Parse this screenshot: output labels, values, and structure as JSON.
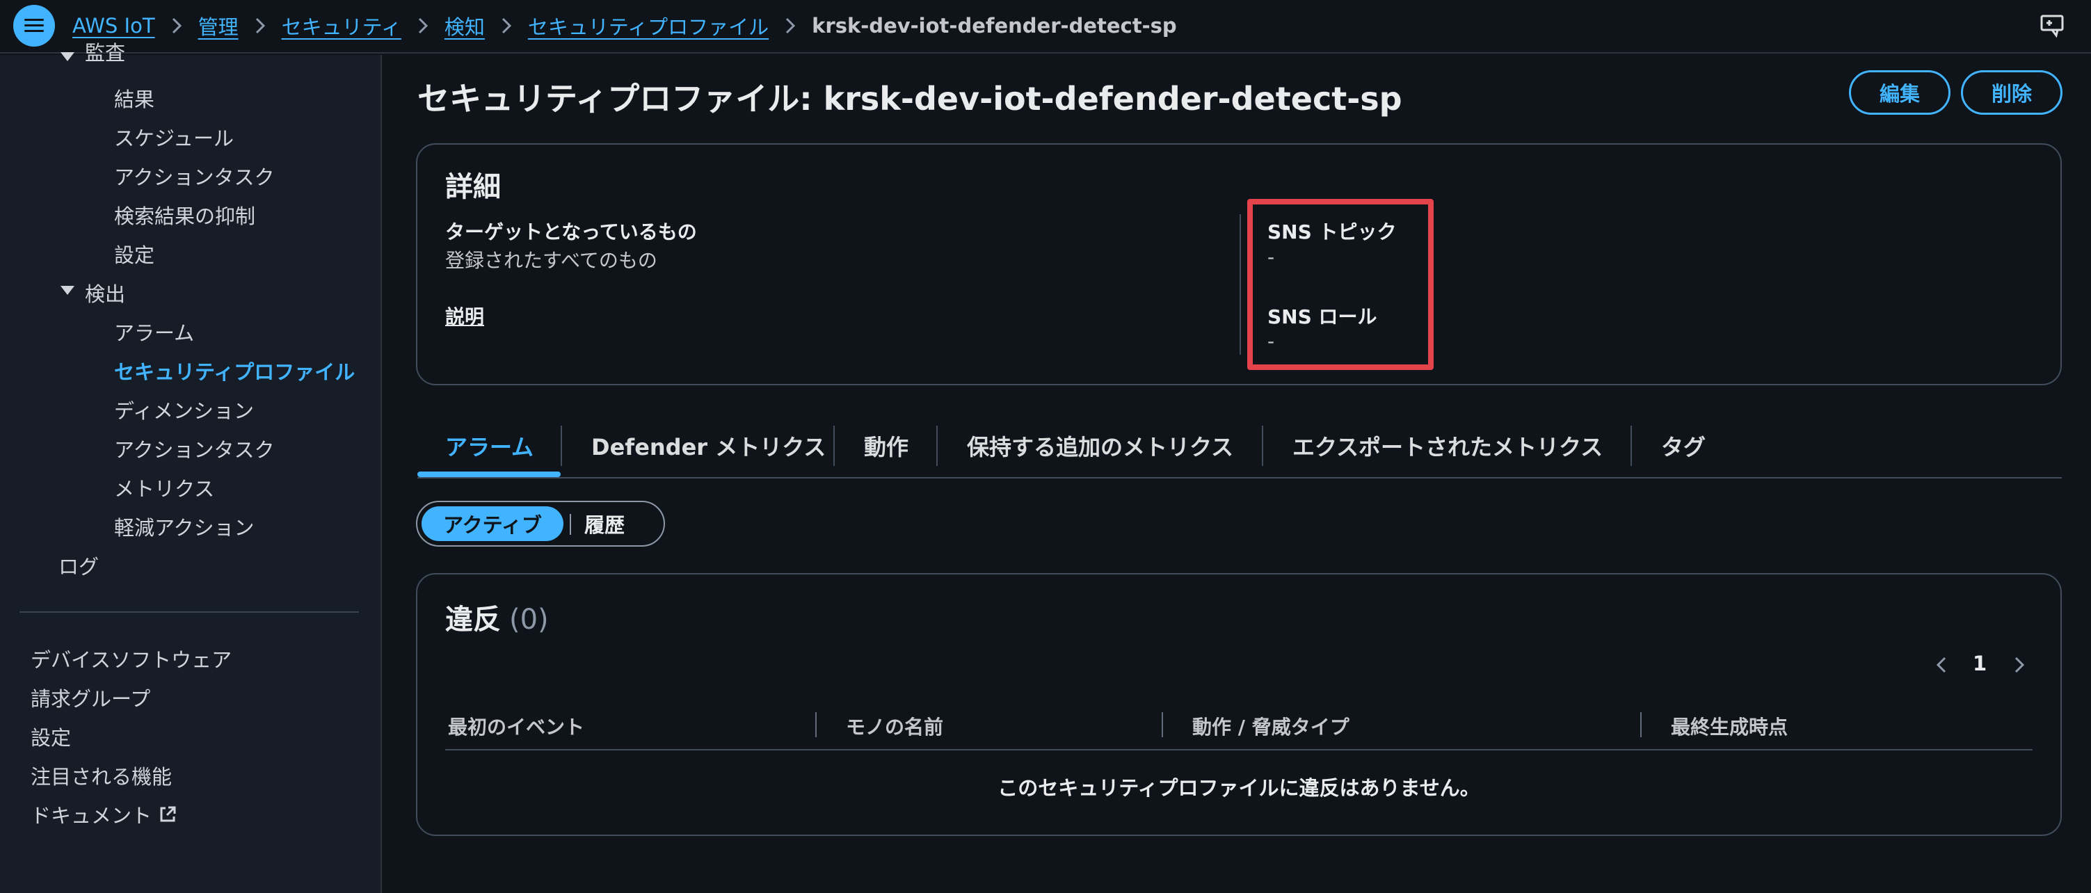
{
  "breadcrumb": {
    "items": [
      "AWS IoT",
      "管理",
      "セキュリティ",
      "検知",
      "セキュリティプロファイル"
    ],
    "current": "krsk-dev-iot-defender-detect-sp"
  },
  "sidebar": {
    "partial_top": "監査",
    "audit_items": [
      "結果",
      "スケジュール",
      "アクションタスク",
      "検索結果の抑制",
      "設定"
    ],
    "detect_label": "検出",
    "detect_items": [
      "アラーム",
      "セキュリティプロファイル",
      "ディメンション",
      "アクションタスク",
      "メトリクス",
      "軽減アクション"
    ],
    "logs": "ログ",
    "bottom_items": [
      "デバイスソフトウェア",
      "請求グループ",
      "設定",
      "注目される機能",
      "ドキュメント"
    ]
  },
  "page": {
    "title": "セキュリティプロファイル: krsk-dev-iot-defender-detect-sp",
    "edit_button": "編集",
    "delete_button": "削除"
  },
  "details": {
    "heading": "詳細",
    "target_label": "ターゲットとなっているもの",
    "target_value": "登録されたすべてのもの",
    "description_label": "説明",
    "sns_topic_label": "SNS トピック",
    "sns_topic_value": "-",
    "sns_role_label": "SNS ロール",
    "sns_role_value": "-"
  },
  "tabs": [
    "アラーム",
    "Defender メトリクス",
    "動作",
    "保持する追加のメトリクス",
    "エクスポートされたメトリクス",
    "タグ"
  ],
  "segment": {
    "active": "アクティブ",
    "history": "履歴"
  },
  "violations": {
    "title": "違反",
    "count": "(0)",
    "page": "1",
    "columns": [
      "最初のイベント",
      "モノの名前",
      "動作 / 脅威タイプ",
      "最終生成時点"
    ],
    "empty_message": "このセキュリティプロファイルに違反はありません。"
  },
  "colors": {
    "accent": "#42b4ff",
    "background": "#0f141a",
    "sidebar": "#161d26",
    "highlight": "#e5434b"
  }
}
